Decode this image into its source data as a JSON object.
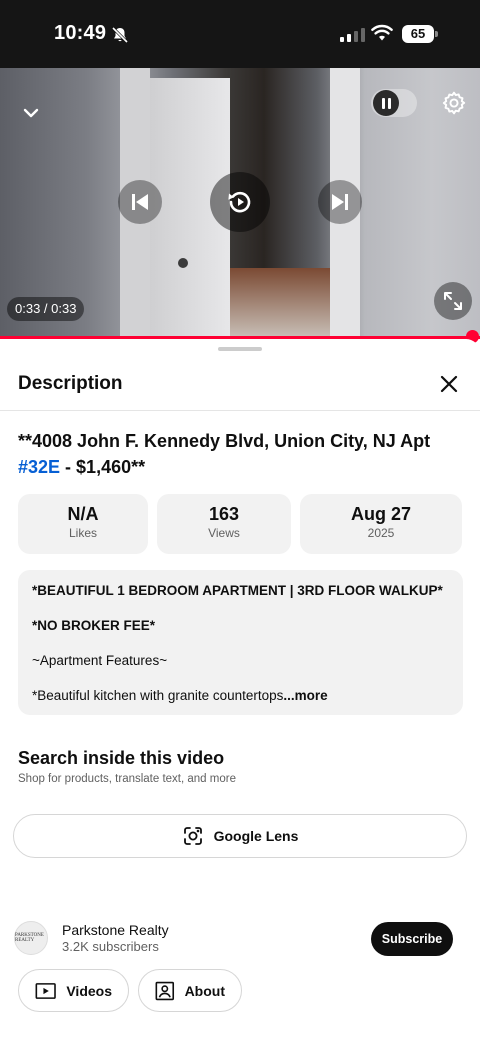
{
  "status_bar": {
    "time": "10:49",
    "battery": "65"
  },
  "player": {
    "time_display": "0:33 / 0:33",
    "progress": 1.0,
    "accent_color": "#ff0033"
  },
  "description_sheet": {
    "title": "Description",
    "video_title_before": "**4008 John F. Kennedy Blvd, Union City, NJ Apt ",
    "video_title_hashtag": "#32E",
    "video_title_after": " - $1,460**",
    "hashtag_color": "#065fd4",
    "stats": [
      {
        "value": "N/A",
        "label": "Likes"
      },
      {
        "value": "163",
        "label": "Views"
      },
      {
        "value": "Aug 27",
        "label": "2025"
      }
    ],
    "description_lines": [
      "*BEAUTIFUL 1 BEDROOM APARTMENT | 3RD FLOOR WALKUP*",
      "*NO BROKER FEE*",
      "~Apartment Features~",
      "*Beautiful kitchen with granite countertops"
    ],
    "more_label": "...more",
    "search_section": {
      "title": "Search inside this video",
      "subtitle": "Shop for products, translate text, and more",
      "lens_label": "Google Lens"
    },
    "channel": {
      "name": "Parkstone Realty",
      "subscribers": "3.2K subscribers",
      "avatar_text": "PARKSTONE REALTY",
      "subscribe_label": "Subscribe"
    },
    "pills": [
      {
        "label": "Videos",
        "icon": "video-icon"
      },
      {
        "label": "About",
        "icon": "person-icon"
      }
    ]
  }
}
